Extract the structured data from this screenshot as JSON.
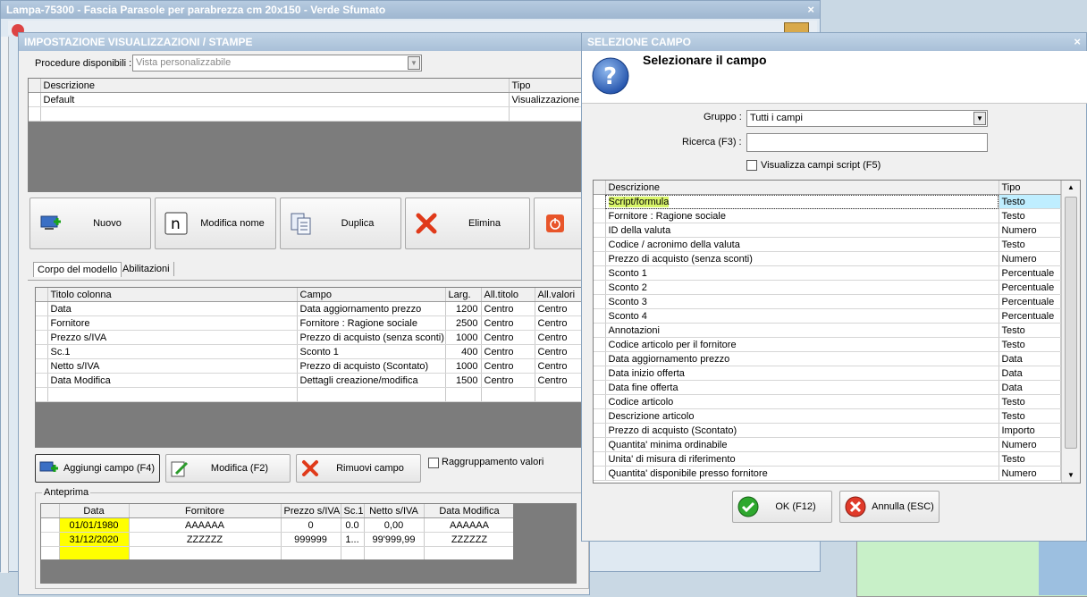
{
  "back_window": {
    "title": "Lampa-75300 - Fascia Parasole per parabrezza cm 20x150 - Verde Sfumato",
    "close": "×",
    "fields": [
      "Data aggiornamento prezzo",
      "Fornitore : Ragione sociale",
      "Prezzo di acquisto (senza sconti)",
      "Sconto 1",
      "Prezzo di acquisto (Scontato)",
      "Dettagli creazione/modifica"
    ]
  },
  "main_dialog": {
    "title": "IMPOSTAZIONE VISUALIZZAZIONI / STAMPE",
    "procedure_label": "Procedure disponibili :",
    "procedure_placeholder": "Vista personalizzabile",
    "views_grid": {
      "columns": [
        "Descrizione",
        "Tipo"
      ],
      "rows": [
        {
          "descrizione": "Default",
          "tipo": "Visualizzazione"
        }
      ]
    },
    "toolbar": {
      "nuovo": "Nuovo",
      "modifica_nome": "Modifica nome",
      "duplica": "Duplica",
      "elimina": "Elimina"
    },
    "tabs": [
      "Corpo del modello",
      "Abilitazioni"
    ],
    "columns_grid": {
      "columns": [
        "Titolo colonna",
        "Campo",
        "Larg.",
        "All.titolo",
        "All.valori"
      ],
      "rows": [
        {
          "titolo": "Data",
          "campo": "Data aggiornamento prezzo",
          "larg": "1200",
          "all_titolo": "Centro",
          "all_valori": "Centro"
        },
        {
          "titolo": "Fornitore",
          "campo": "Fornitore : Ragione sociale",
          "larg": "2500",
          "all_titolo": "Centro",
          "all_valori": "Centro"
        },
        {
          "titolo": "Prezzo s/IVA",
          "campo": "Prezzo di acquisto (senza sconti)",
          "larg": "1000",
          "all_titolo": "Centro",
          "all_valori": "Centro"
        },
        {
          "titolo": "Sc.1",
          "campo": "Sconto 1",
          "larg": "400",
          "all_titolo": "Centro",
          "all_valori": "Centro"
        },
        {
          "titolo": "Netto s/IVA",
          "campo": "Prezzo di acquisto (Scontato)",
          "larg": "1000",
          "all_titolo": "Centro",
          "all_valori": "Centro"
        },
        {
          "titolo": "Data Modifica",
          "campo": "Dettagli creazione/modifica",
          "larg": "1500",
          "all_titolo": "Centro",
          "all_valori": "Centro"
        }
      ]
    },
    "actions": {
      "aggiungi": "Aggiungi campo (F4)",
      "modifica": "Modifica (F2)",
      "rimuovi": "Rimuovi campo",
      "raggruppamento": "Raggruppamento valori"
    },
    "preview": {
      "label": "Anteprima",
      "columns": [
        "Data",
        "Fornitore",
        "Prezzo s/IVA",
        "Sc.1",
        "Netto s/IVA",
        "Data Modifica"
      ],
      "rows": [
        [
          "01/01/1980",
          "AAAAAA",
          "0",
          "0.0",
          "0,00",
          "AAAAAA"
        ],
        [
          "31/12/2020",
          "ZZZZZZ",
          "999999",
          "1...",
          "99'999,99",
          "ZZZZZZ"
        ]
      ]
    }
  },
  "select_dialog": {
    "title": "SELEZIONE CAMPO",
    "close": "×",
    "heading": "Selezionare il campo",
    "gruppo_label": "Gruppo :",
    "gruppo_value": "Tutti i campi",
    "ricerca_label": "Ricerca (F3) :",
    "ricerca_value": "",
    "script_label": "Visualizza campi script (F5)",
    "columns": [
      "Descrizione",
      "Tipo"
    ],
    "rows": [
      {
        "descrizione": "Script/formula",
        "tipo": "Testo"
      },
      {
        "descrizione": "Fornitore : Ragione sociale",
        "tipo": "Testo"
      },
      {
        "descrizione": "ID della valuta",
        "tipo": "Numero"
      },
      {
        "descrizione": "Codice / acronimo della valuta",
        "tipo": "Testo"
      },
      {
        "descrizione": "Prezzo di acquisto (senza sconti)",
        "tipo": "Numero"
      },
      {
        "descrizione": "Sconto 1",
        "tipo": "Percentuale"
      },
      {
        "descrizione": "Sconto 2",
        "tipo": "Percentuale"
      },
      {
        "descrizione": "Sconto 3",
        "tipo": "Percentuale"
      },
      {
        "descrizione": "Sconto 4",
        "tipo": "Percentuale"
      },
      {
        "descrizione": "Annotazioni",
        "tipo": "Testo"
      },
      {
        "descrizione": "Codice articolo per il fornitore",
        "tipo": "Testo"
      },
      {
        "descrizione": "Data aggiornamento prezzo",
        "tipo": "Data"
      },
      {
        "descrizione": "Data inizio offerta",
        "tipo": "Data"
      },
      {
        "descrizione": "Data fine offerta",
        "tipo": "Data"
      },
      {
        "descrizione": "Codice articolo",
        "tipo": "Testo"
      },
      {
        "descrizione": "Descrizione articolo",
        "tipo": "Testo"
      },
      {
        "descrizione": "Prezzo di acquisto (Scontato)",
        "tipo": "Importo"
      },
      {
        "descrizione": "Quantita' minima ordinabile",
        "tipo": "Numero"
      },
      {
        "descrizione": "Unita' di misura di riferimento",
        "tipo": "Testo"
      },
      {
        "descrizione": "Quantita' disponibile presso fornitore",
        "tipo": "Numero"
      }
    ],
    "ok": "OK (F12)",
    "annulla": "Annulla (ESC)"
  }
}
